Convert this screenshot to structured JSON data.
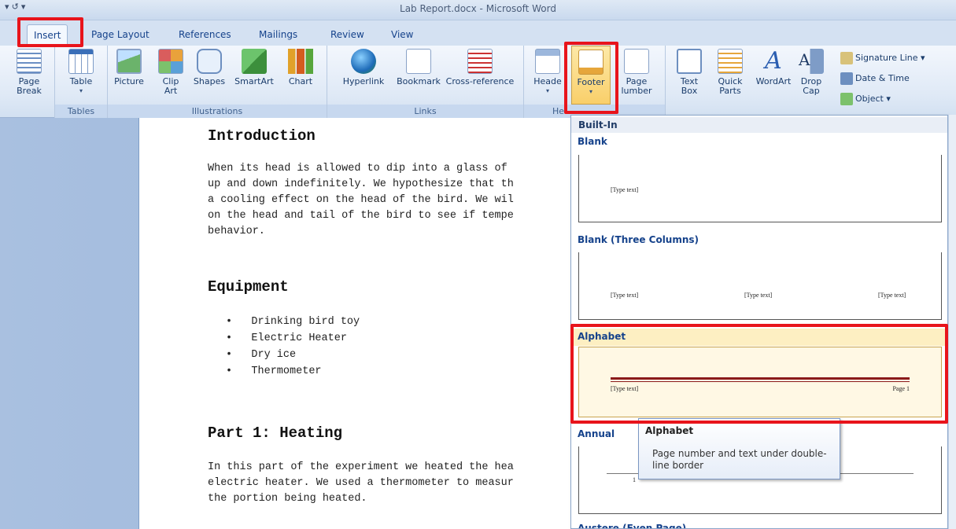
{
  "window": {
    "title": "Lab Report.docx - Microsoft Word"
  },
  "tabs": [
    "Insert",
    "Page Layout",
    "References",
    "Mailings",
    "Review",
    "View"
  ],
  "ribbon": {
    "pages_group": {
      "page_break_label_1": "Page",
      "page_break_label_2": "Break"
    },
    "tables_group": {
      "label": "Tables",
      "table_btn": "Table"
    },
    "illustrations_group": {
      "label": "Illustrations",
      "picture": "Picture",
      "clip_art_1": "Clip",
      "clip_art_2": "Art",
      "shapes": "Shapes",
      "smartart": "SmartArt",
      "chart": "Chart"
    },
    "links_group": {
      "label": "Links",
      "hyperlink": "Hyperlink",
      "bookmark": "Bookmark",
      "cross_reference": "Cross-reference"
    },
    "header_footer_group": {
      "label": "He",
      "header": "Heade",
      "footer": "Footer",
      "page_number_1": "Page",
      "page_number_2": "lumber"
    },
    "text_group": {
      "text_box_1": "Text",
      "text_box_2": "Box",
      "quick_parts_1": "Quick",
      "quick_parts_2": "Parts",
      "wordart": "WordArt",
      "drop_cap_1": "Drop",
      "drop_cap_2": "Cap",
      "signature_line": "Signature Line",
      "date_time": "Date & Time",
      "object": "Object"
    }
  },
  "document": {
    "intro_heading": "Introduction",
    "intro_lines": [
      "When its head is allowed to dip into a glass of",
      "up and down indefinitely. We hypothesize that th",
      "a cooling effect on the head of the bird. We wil",
      "on the head and tail of the bird to see if tempe",
      "behavior."
    ],
    "equipment_heading": "Equipment",
    "equipment_items": [
      "Drinking bird toy",
      "Electric Heater",
      "Dry ice",
      "Thermometer"
    ],
    "part1_heading": "Part 1: Heating",
    "part1_lines": [
      "In this part of the experiment we heated the hea",
      "electric heater. We used a thermometer to measur",
      "the portion being heated."
    ]
  },
  "gallery": {
    "header": "Built-In",
    "sections": {
      "blank": "Blank",
      "blank_three": "Blank (Three Columns)",
      "alphabet": "Alphabet",
      "annual": "Annual",
      "austere": "Austere (Even Page)"
    },
    "placeholder": "[Type text]",
    "page_label": "Page 1",
    "annual_page_num": "1"
  },
  "tooltip": {
    "title": "Alphabet",
    "body": "Page number and text under double-line border"
  },
  "colors": {
    "highlight": "#e8141b",
    "footer_selected": "#f9d77a",
    "alphabet_rule": "#8b1a1a"
  }
}
